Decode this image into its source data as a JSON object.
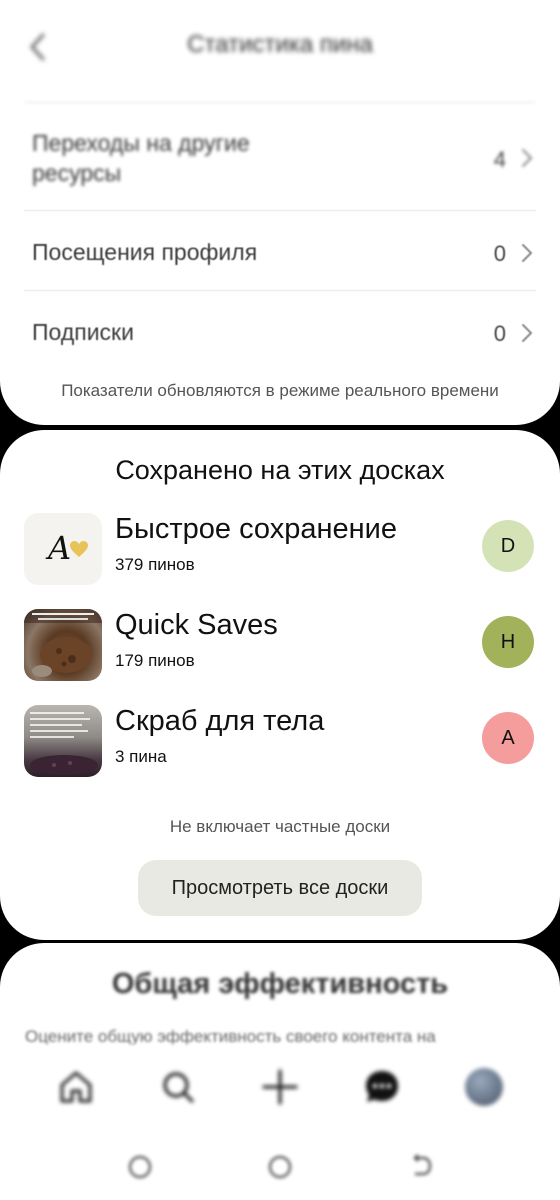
{
  "header": {
    "title": "Статистика пина"
  },
  "stats": [
    {
      "label": "Переходы на другие ресурсы",
      "value": "4"
    },
    {
      "label": "Посещения профиля",
      "value": "0"
    },
    {
      "label": "Подписки",
      "value": "0"
    }
  ],
  "realtime_note": "Показатели обновляются в режиме реального времени",
  "boards_section": {
    "title": "Сохранено на этих досках",
    "boards": [
      {
        "name": "Быстрое сохранение",
        "count": "379 пинов",
        "thumb_text": "A",
        "avatar_letter": "D",
        "avatar_color": "#d4e3b6"
      },
      {
        "name": "Quick Saves",
        "count": "179 пинов",
        "avatar_letter": "H",
        "avatar_color": "#a1b25b"
      },
      {
        "name": "Скраб для тела",
        "count": "3 пина",
        "avatar_letter": "A",
        "avatar_color": "#f59c9c"
      }
    ],
    "private_note": "Не включает частные доски",
    "view_all_label": "Просмотреть все доски"
  },
  "performance": {
    "title": "Общая эффективность",
    "subtitle": "Оцените общую эффективность своего контента на"
  },
  "bottom_nav": {
    "items": [
      "home-icon",
      "search-icon",
      "create-icon",
      "messages-icon",
      "profile-avatar"
    ]
  },
  "system_nav": {
    "items": [
      "recent-apps-icon",
      "home-circle-icon",
      "back-arrow-icon"
    ]
  }
}
